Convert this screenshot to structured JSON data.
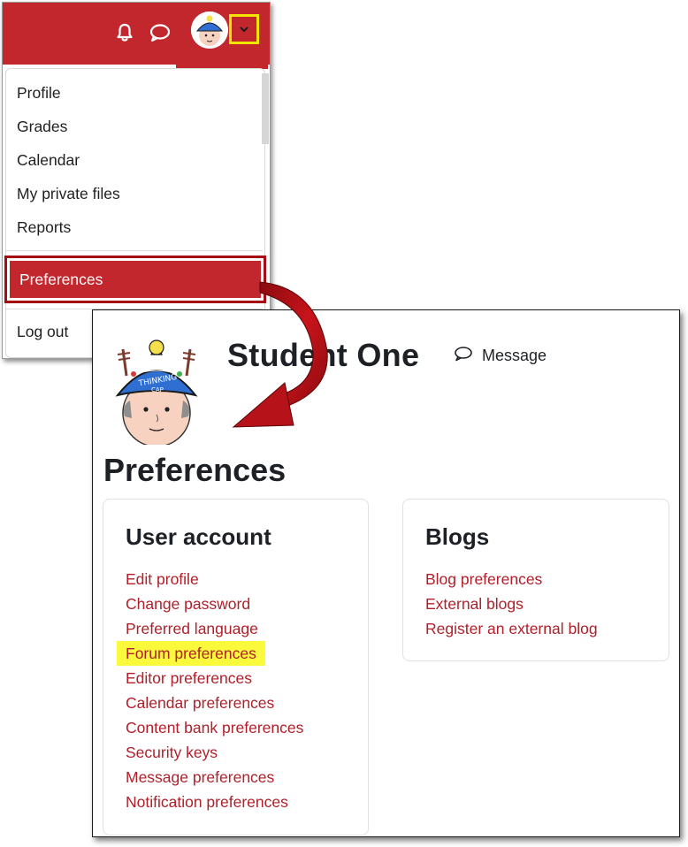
{
  "navbar": {
    "icons": [
      "bell-icon",
      "chat-icon",
      "chevron-down-icon"
    ],
    "accent_color": "#c1272d",
    "highlight_color": "#f2e600"
  },
  "user_menu": {
    "items": [
      "Profile",
      "Grades",
      "Calendar",
      "My private files",
      "Reports"
    ],
    "preferences_label": "Preferences",
    "logout_label": "Log out"
  },
  "profile": {
    "name": "Student  One",
    "message_label": "Message"
  },
  "page": {
    "heading": "Preferences",
    "cards": [
      {
        "title": "User account",
        "links": [
          "Edit profile",
          "Change password",
          "Preferred language",
          "Forum preferences",
          "Editor preferences",
          "Calendar preferences",
          "Content bank preferences",
          "Security keys",
          "Message preferences",
          "Notification preferences"
        ]
      },
      {
        "title": "Blogs",
        "links": [
          "Blog preferences",
          "External blogs",
          "Register an external blog"
        ]
      }
    ],
    "link_color": "#b0202a",
    "highlighted_link": "Forum preferences"
  }
}
